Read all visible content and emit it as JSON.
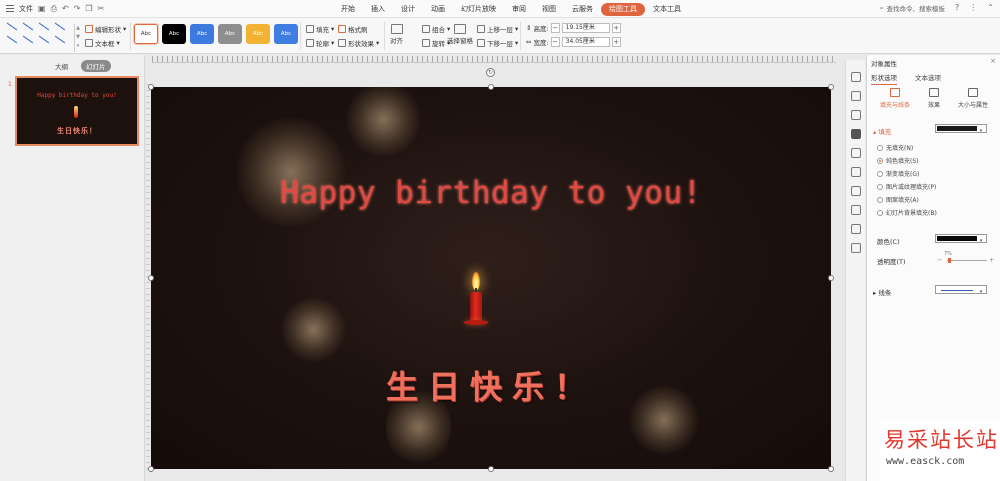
{
  "titlebar": {
    "file_menu": "文件",
    "tabs": [
      {
        "label": "开始"
      },
      {
        "label": "插入"
      },
      {
        "label": "设计"
      },
      {
        "label": "动画"
      },
      {
        "label": "幻灯片放映"
      },
      {
        "label": "审阅"
      },
      {
        "label": "视图"
      },
      {
        "label": "云服务"
      },
      {
        "label": "绘图工具"
      },
      {
        "label": "文本工具"
      }
    ],
    "active_tab": "绘图工具",
    "search_placeholder": "查找命令、搜索模板"
  },
  "ribbon": {
    "edit_shape": "编辑形状",
    "text_box": "文本框",
    "styles": [
      {
        "label": "Abc",
        "bg": "#ffffff",
        "fg": "#333333"
      },
      {
        "label": "Abc",
        "bg": "#000000",
        "fg": "#ffffff"
      },
      {
        "label": "Abc",
        "bg": "#3d7ae0",
        "fg": "#ffffff"
      },
      {
        "label": "Abc",
        "bg": "#8e8e8e",
        "fg": "#ffffff"
      },
      {
        "label": "Abc",
        "bg": "#f2b233",
        "fg": "#ffffff"
      },
      {
        "label": "Abc",
        "bg": "#3f7de3",
        "fg": "#ffffff"
      }
    ],
    "fill": "填充",
    "outline": "轮廓",
    "format_painter": "格式刷",
    "shape_effect": "形状效果",
    "align": "对齐",
    "group": "组合",
    "rotate": "旋转",
    "selection_pane": "选择窗格",
    "bring_forward": "上移一层",
    "send_backward": "下移一层",
    "height_label": "高度:",
    "height_value": "19.15厘米",
    "width_label": "宽度:",
    "width_value": "34.05厘米"
  },
  "left_pane": {
    "tab_outline": "大纲",
    "tab_slides": "幻灯片",
    "slide_number": "1"
  },
  "slide": {
    "title": "Happy birthday to you!",
    "subtitle_cn": "生日快乐！"
  },
  "right_pane": {
    "title": "对象属性",
    "tab_shape": "形状选项",
    "tab_text": "文本选项",
    "sub_fill_line": "填充与线条",
    "sub_effect": "效果",
    "sub_size": "大小与属性",
    "fill_section": "填充",
    "fill_options": [
      {
        "label": "无填充(N)",
        "selected": false
      },
      {
        "label": "纯色填充(S)",
        "selected": true
      },
      {
        "label": "渐变填充(G)",
        "selected": false
      },
      {
        "label": "图片或纹理填充(P)",
        "selected": false
      },
      {
        "label": "图案填充(A)",
        "selected": false
      },
      {
        "label": "幻灯片背景填充(B)",
        "selected": false
      }
    ],
    "color_label": "颜色(C)",
    "transparency_label": "透明度(T)",
    "transparency_value": "7%",
    "line_section": "线条"
  },
  "watermark": {
    "cn": "易采站长站",
    "url": "www.easck.com"
  }
}
